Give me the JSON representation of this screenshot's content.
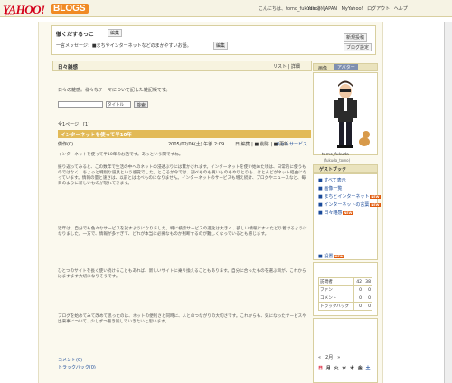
{
  "header": {
    "logo_yahoo": "YAHOO!",
    "logo_blogs": "BLOGS",
    "logo_sub": "JAPAN",
    "greeting": "こんにちは、tomo_fukuda さん",
    "links": [
      "ヘルプ",
      "Yahoo! JAPAN",
      "MyYahoo!",
      "ログアウト",
      "ヘルプ"
    ]
  },
  "blog": {
    "title": "徹くだするっこ",
    "edit_label": "編集",
    "message_label": "一言メッセージ：",
    "message": "■まちやインターネットなどのまかやすいお話。",
    "edit_label2": "編集",
    "new_post": "新規投稿",
    "settings": "ブログ設定"
  },
  "section": {
    "title": "日々雑感",
    "links": "リスト | 詳細",
    "description": "日々の雑感。様々なテーマについて記した雑記帳です。"
  },
  "search": {
    "placeholder": "",
    "select_value": "タイトル",
    "button": "検索"
  },
  "pager": "全1ページ　[1]",
  "article": {
    "title": "インターネットを使って半10年",
    "author": "傑作(0)",
    "date": "2005/02/06(土) 午後 2:09",
    "icons": "日 編集 | ■ 削除 | ■ 更新",
    "category": "ネットサービス",
    "paragraphs": [
      "インターネットを使って半10年のお話です。あっという間ですね。",
      "振り返ってみると、この数年で生活の中へのネットの浸透ぶりには驚かされます。インターネットを使い始めた頃は、日常的に使うものではなく、ちょっと特別な道具という感覚でした。ところが今では、調べものも買いものもやりとりも、ほとんどがネット経由になっています。情報の量と速さは、以前とは比べものになりません。インターネットのサービスも増え続け、ブログやニュースなど、毎日のように新しいものが現れてきます。",
      "近年は、自分でも色々なサービスを試すようになりました。特に検索サービスの進化は大きく、欲しい情報にすぐたどり着けるようになりました。一方で、情報が多すぎて、どれが本当に必要なものか判断するのが難しくなっているとも感じます。",
      "ひとつのサイトを長く使い続けることもあれば、新しいサイトに乗り換えることもあります。自分に合ったものを選ぶ目が、これからはますます大切になりそうです。",
      "ブログを始めてみて改めて思ったのは、ネットの便利さと同時に、人とのつながりの大切さです。これからも、気になったサービスや出来事について、少しずつ書き残していきたいと思います。"
    ],
    "comments": "コメント(0)",
    "trackbacks": "トラックバック(0)"
  },
  "sidebar": {
    "tab_profile": "画像",
    "tab_avatar": "アバター",
    "avatar_name": "tomo_fukuda",
    "avatar_handle": "(fukuda_tomo)",
    "nickname": "ゲストブック",
    "items": [
      {
        "label": "すべて表示",
        "badge": ""
      },
      {
        "label": "画像一覧",
        "badge": ""
      },
      {
        "label": "まちとインターネット",
        "badge": "NEW"
      },
      {
        "label": "インターネットの言葉",
        "badge": "NEW"
      },
      {
        "label": "日々雑感",
        "badge": "NEW"
      },
      {
        "label": "設置",
        "badge": "NEW"
      }
    ],
    "stats": [
      {
        "label": "訪問者",
        "a": "42",
        "b": "38"
      },
      {
        "label": "ファン",
        "a": "0",
        "b": "0"
      },
      {
        "label": "コメント",
        "a": "0",
        "b": "0"
      },
      {
        "label": "トラックバック",
        "a": "0",
        "b": "0"
      }
    ],
    "calendar_header": "«　2月　»",
    "calendar_sun": "日",
    "calendar_days": "月 火 水 木 金",
    "calendar_sat": "土"
  },
  "colors": {
    "logo_red": "#d4001a",
    "blogs_orange": "#f08a24",
    "article_bar": "#e2ba57",
    "link_blue": "#1a4a99"
  }
}
